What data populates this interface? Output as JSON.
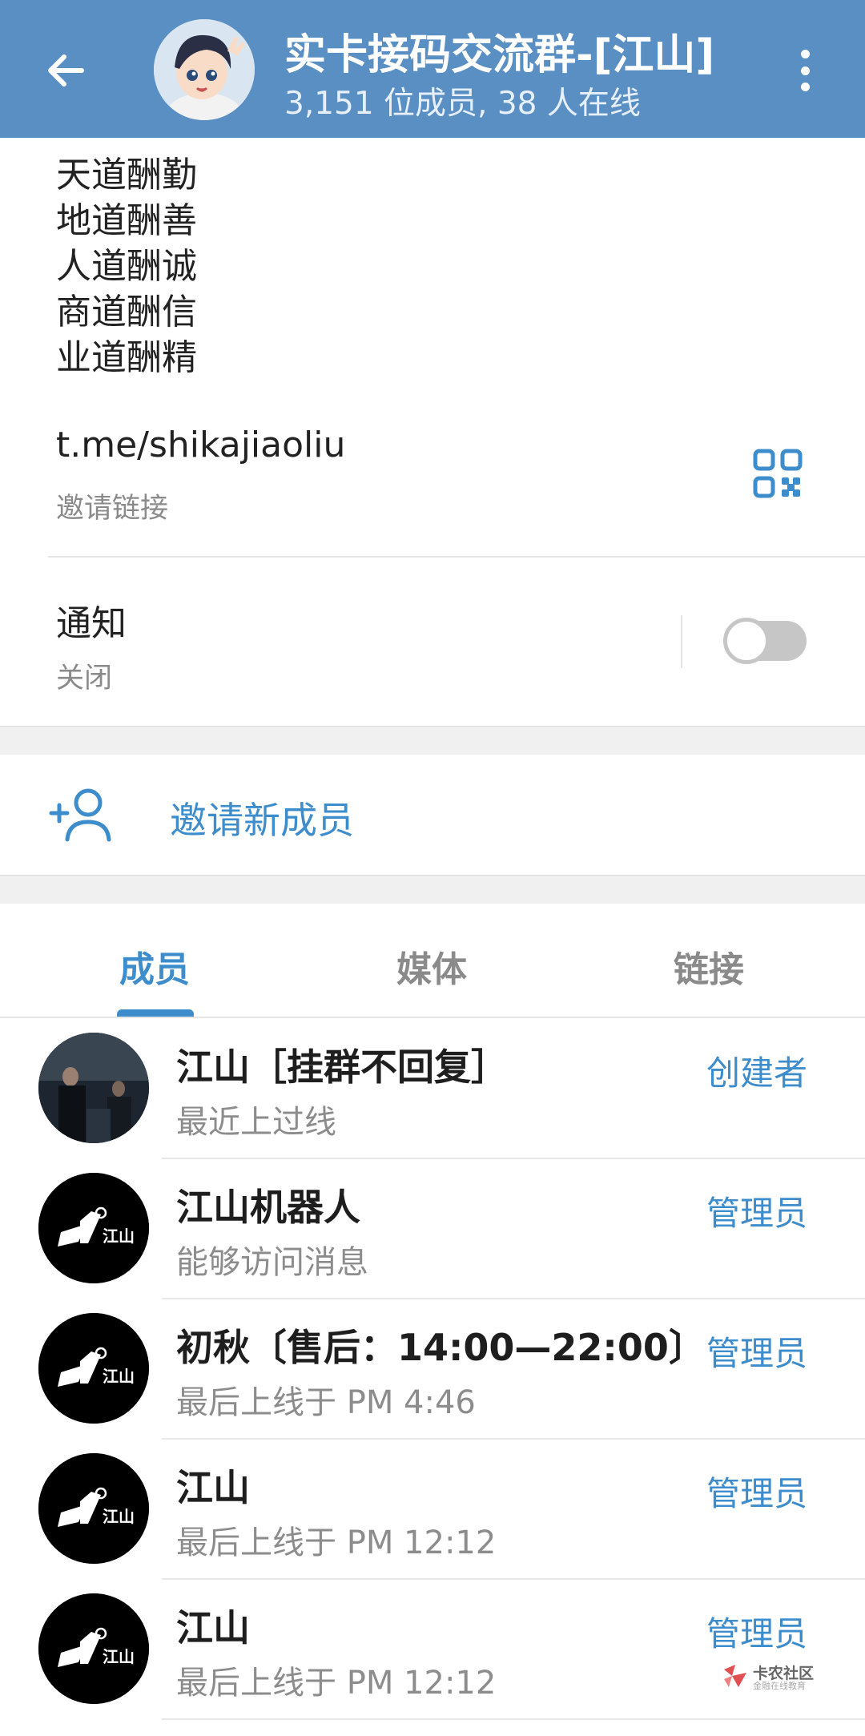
{
  "header": {
    "title": "实卡接码交流群-[江山]",
    "subtitle": "3,151 位成员, 38 人在线",
    "back_icon": "arrow-left-icon",
    "more_icon": "more-vertical-icon"
  },
  "description": {
    "lines": [
      "天道酬勤",
      "地道酬善",
      "人道酬诚",
      "商道酬信",
      "业道酬精"
    ]
  },
  "invite_link": {
    "url": "t.me/shikajiaoliu",
    "caption": "邀请链接",
    "icon": "qr-code-icon"
  },
  "notifications": {
    "label": "通知",
    "state": "关闭",
    "enabled": false
  },
  "invite_members": {
    "label": "邀请新成员",
    "icon": "add-user-icon"
  },
  "tabs": [
    {
      "label": "成员",
      "active": true
    },
    {
      "label": "媒体",
      "active": false
    },
    {
      "label": "链接",
      "active": false
    }
  ],
  "members": [
    {
      "name": "江山［挂群不回复］",
      "status": "最近上过线",
      "role": "创建者",
      "avatar": "photo"
    },
    {
      "name": "江山机器人",
      "status": "能够访问消息",
      "role": "管理员",
      "avatar": "js-logo"
    },
    {
      "name": "初秋〔售后：14:00—22:00〕",
      "status": "最后上线于 PM 4:46",
      "role": "管理员",
      "avatar": "js-logo"
    },
    {
      "name": "江山",
      "status": "最后上线于 PM 12:12",
      "role": "管理员",
      "avatar": "js-logo"
    },
    {
      "name": "江山",
      "status": "最后上线于 PM 12:12",
      "role": "管理员",
      "avatar": "js-logo"
    }
  ],
  "colors": {
    "header": "#5a8fc4",
    "accent": "#3d8ccc",
    "secondary_text": "#8a8a8a"
  },
  "watermark": {
    "text": "卡农社区",
    "sub": "金融在线教育"
  }
}
